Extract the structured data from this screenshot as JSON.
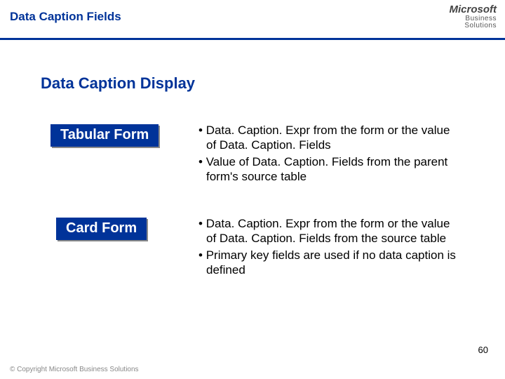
{
  "header": {
    "title": "Data Caption Fields",
    "logo_line1": "Microsoft",
    "logo_line2": "Business",
    "logo_line3": "Solutions"
  },
  "section": {
    "title": "Data Caption Display"
  },
  "blocks": [
    {
      "label": "Tabular Form",
      "bullets": [
        "Data. Caption. Expr from the form or the value of Data. Caption. Fields",
        "Value of Data. Caption. Fields from the parent form's source table"
      ]
    },
    {
      "label": "Card Form",
      "bullets": [
        "Data. Caption. Expr from the form or the value of Data. Caption. Fields from the source table",
        "Primary key fields are used if no data caption is defined"
      ]
    }
  ],
  "page_number": "60",
  "footer": "© Copyright Microsoft Business Solutions"
}
